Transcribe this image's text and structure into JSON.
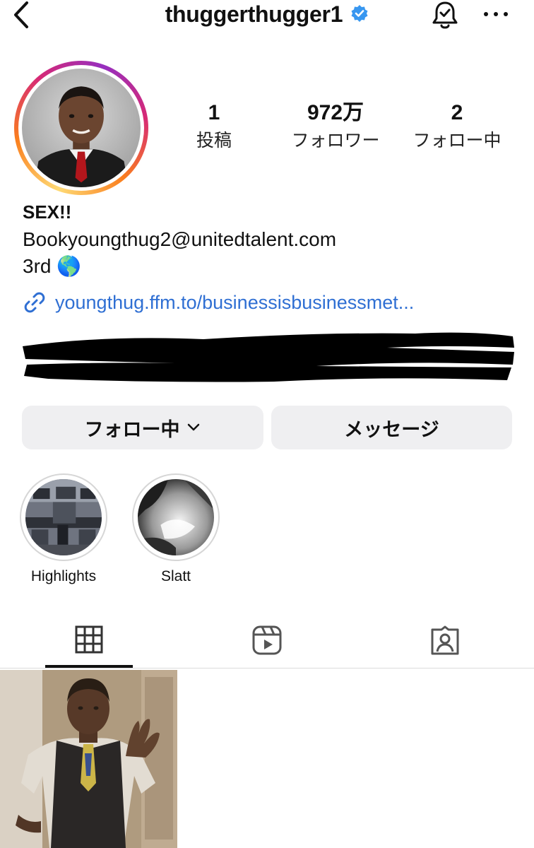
{
  "header": {
    "username": "thuggerthugger1",
    "icons": [
      "back-chevron-icon",
      "verified-badge-icon",
      "notification-bell-icon",
      "more-options-icon"
    ]
  },
  "profile": {
    "stats": [
      {
        "value": "1",
        "label": "投稿"
      },
      {
        "value": "972万",
        "label": "フォロワー"
      },
      {
        "value": "2",
        "label": "フォロー中"
      }
    ],
    "bio": {
      "name": "SEX!!",
      "email": "Bookyoungthug2@unitedtalent.com",
      "line3": "3rd 🌎",
      "link": "youngthug.ffm.to/businessisbusinessmet..."
    }
  },
  "actions": {
    "follow_label": "フォロー中",
    "message_label": "メッセージ"
  },
  "highlights": [
    {
      "label": "Highlights"
    },
    {
      "label": "Slatt"
    }
  ],
  "tabs": {
    "active": "posts-grid",
    "items": [
      "grid-icon",
      "reels-icon",
      "tagged-icon"
    ]
  },
  "colors": {
    "link": "#2f6fd3",
    "verified": "#3897f0",
    "button_bg": "#efeff1"
  }
}
